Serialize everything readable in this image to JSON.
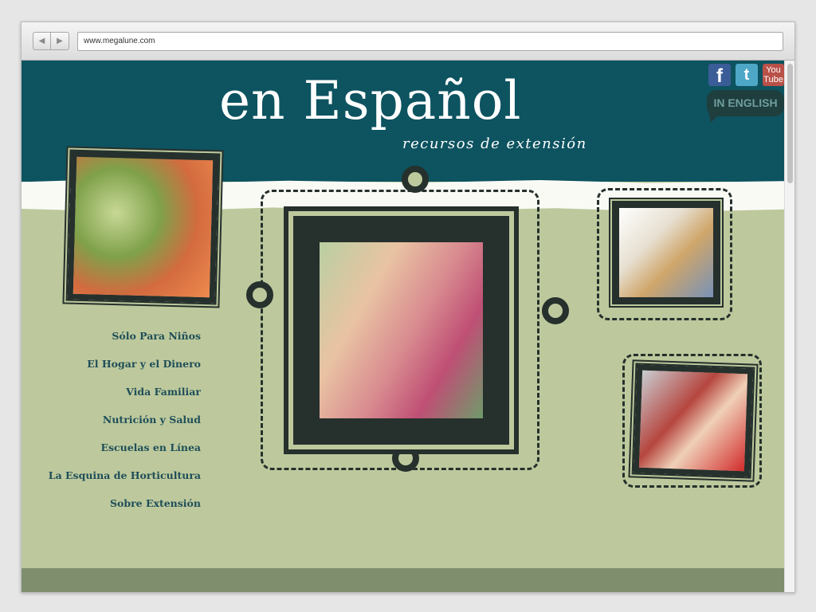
{
  "browser": {
    "url": "www.megalune.com",
    "back_glyph": "◀",
    "forward_glyph": "▶"
  },
  "site": {
    "title": "en Español",
    "subtitle": "recursos de extensión"
  },
  "social": {
    "facebook_glyph": "f",
    "twitter_glyph": "t",
    "youtube_text": "You Tube"
  },
  "language_toggle": "IN ENGLISH",
  "nav": [
    {
      "label": "Sólo Para Niños"
    },
    {
      "label": "El Hogar y el Dinero"
    },
    {
      "label": "Vida Familiar"
    },
    {
      "label": "Nutrición y Salud"
    },
    {
      "label": "Escuelas en Línea"
    },
    {
      "label": "La Esquina de Horticultura"
    },
    {
      "label": "Sobre Extensión"
    }
  ],
  "colors": {
    "header": "#0d5360",
    "background": "#bdc99d",
    "nav_text": "#1f4e58",
    "frame": "#26302c"
  }
}
